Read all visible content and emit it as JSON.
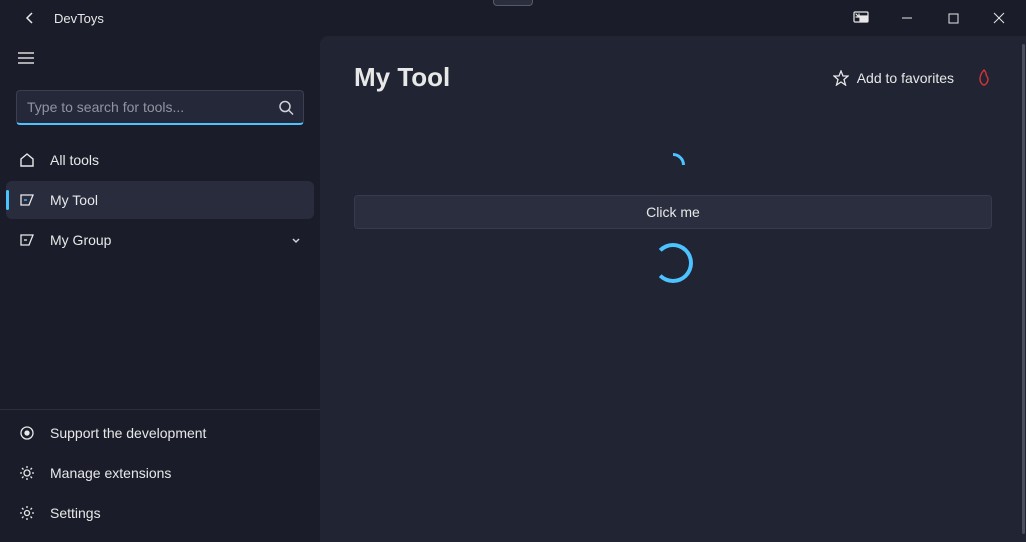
{
  "app": {
    "title": "DevToys"
  },
  "search": {
    "placeholder": "Type to search for tools..."
  },
  "nav": {
    "all_tools": "All tools",
    "my_tool": "My Tool",
    "my_group": "My Group"
  },
  "sidebar_bottom": {
    "support": "Support the development",
    "extensions": "Manage extensions",
    "settings": "Settings"
  },
  "page": {
    "title": "My Tool",
    "favorites_label": "Add to favorites",
    "button_label": "Click me"
  },
  "colors": {
    "accent": "#4cc2ff",
    "hot": "#d13438"
  }
}
